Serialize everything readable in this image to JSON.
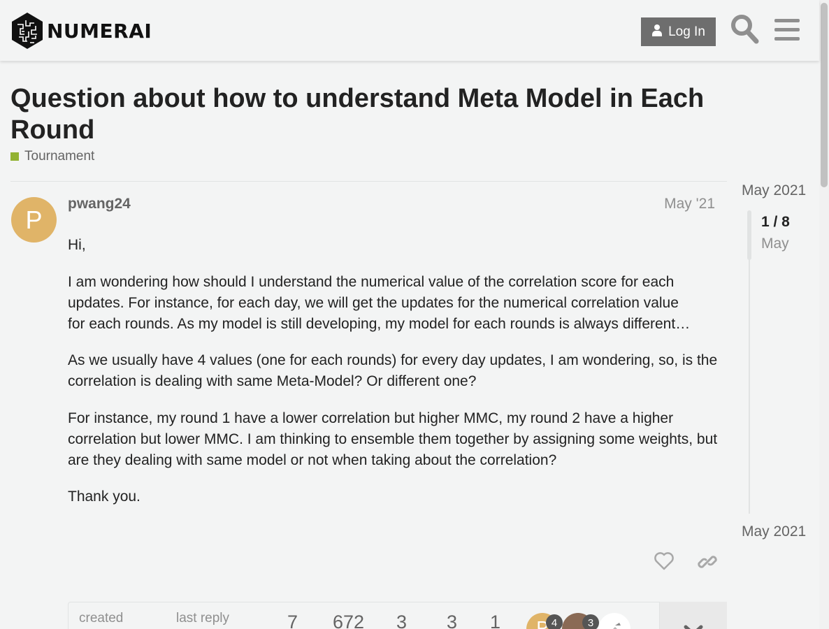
{
  "header": {
    "logo_text": "NUMERAI",
    "login_label": "Log In"
  },
  "topic": {
    "title": "Question about how to understand Meta Model in Each Round",
    "category": "Tournament",
    "category_color": "#92b233"
  },
  "post": {
    "avatar_letter": "P",
    "avatar_color": "#e0b468",
    "username": "pwang24",
    "date": "May '21",
    "paragraphs": [
      "Hi,",
      "I am wondering how should I understand the numerical value of the correlation score for each updates. For instance, for each day, we will get the updates for the numerical correlation value",
      "for each rounds. As my model is still developing, my model for each rounds is always different…",
      "As we usually have 4 values (one for each rounds) for every day updates, I am wondering, so, is the correlation is dealing with same Meta-Model? Or different one?",
      "For instance, my round 1 have a lower correlation but higher MMC, my round 2 have a higher correlation but lower MMC. I am thinking to ensemble them together by assigning some weights, but are they dealing with same model or not when taking about the correlation?",
      "Thank you."
    ]
  },
  "topic_map": {
    "created_label": "created",
    "last_reply_label": "last reply",
    "replies": "7",
    "views": "672",
    "users": "3",
    "likes": "3",
    "links": "1",
    "participants": [
      {
        "letter": "P",
        "color": "#e0b468",
        "count": "4"
      },
      {
        "letter": "",
        "color": "#8a6a55",
        "count": "3"
      },
      {
        "letter": "",
        "color": "#ffffff",
        "count": ""
      }
    ]
  },
  "timeline": {
    "start_date": "May 2021",
    "position": "1 / 8",
    "current_month": "May",
    "end_date": "May 2021"
  }
}
